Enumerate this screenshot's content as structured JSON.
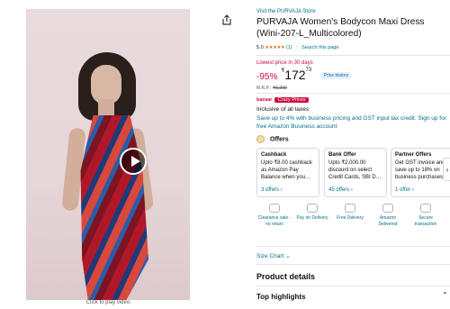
{
  "media": {
    "caption": "Click to play video",
    "share_icon": "share-icon",
    "play_icon": "play-icon"
  },
  "product": {
    "store_link": "Visit the PURVAJA Store",
    "title": "PURVAJA Women's Bodycon Maxi Dress (Wini-207-L_Multicolored)",
    "rating_value": "5.0",
    "stars": "★★★★★",
    "rating_count": "(1)",
    "search_link": "Search this page"
  },
  "price": {
    "deal_label": "Lowest price in 30 days",
    "discount": "-95%",
    "currency": "₹",
    "amount": "172",
    "cents": "73",
    "history_label": "Price history",
    "mrp_label": "M.R.P.:",
    "mrp_value": "₹6,299"
  },
  "bazaar": {
    "label": "bazaar",
    "badge": "Crazy Prices"
  },
  "tax_text": "Inclusive of all taxes",
  "business_text": "Save up to 4% with business pricing and GST input tax credit. Sign up for free Amazon Business account",
  "offers": {
    "heading": "Offers",
    "cards": [
      {
        "title": "Cashback",
        "body": "Upto ₹8.00 cashback as Amazon Pay Balance when you…",
        "link": "3 offers ›"
      },
      {
        "title": "Bank Offer",
        "body": "Upto ₹2,000.00 discount on select Credit Cards, SBI D…",
        "link": "45 offers ›"
      },
      {
        "title": "Partner Offers",
        "body": "Get GST invoice and save up to 18% on business purchases",
        "link": "1 offer ›"
      }
    ],
    "next_arrow": "›"
  },
  "features": [
    {
      "label": "Clearance sale - no return",
      "icon": "tag-icon"
    },
    {
      "label": "Pay on Delivery",
      "icon": "cash-icon"
    },
    {
      "label": "Free Delivery",
      "icon": "truck-icon"
    },
    {
      "label": "Amazon Delivered",
      "icon": "box-icon"
    },
    {
      "label": "Secure transaction",
      "icon": "lock-icon"
    }
  ],
  "size_chart": "Size Chart ⌄",
  "sections": {
    "product_details": "Product details",
    "top_highlights": "Top highlights",
    "chevron": "⌃"
  },
  "colors": {
    "link": "#007185",
    "discount": "#cc0c39",
    "star": "#de7921"
  }
}
